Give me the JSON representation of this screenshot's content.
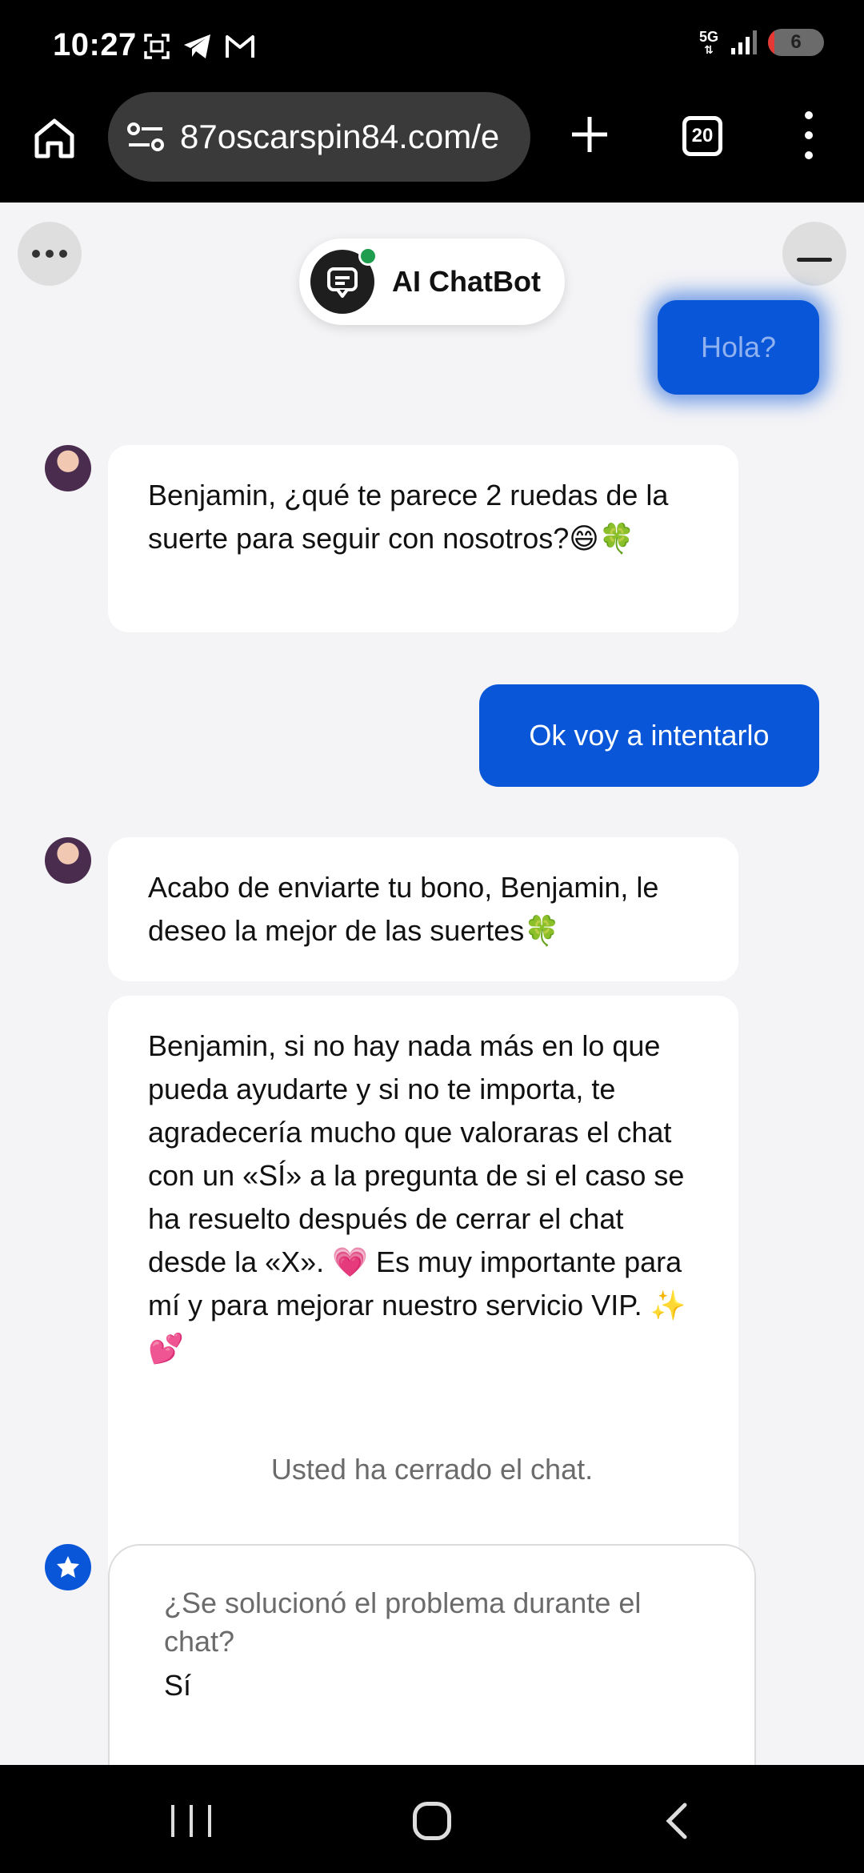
{
  "status_bar": {
    "time": "10:27",
    "network": "5G",
    "battery": "6",
    "battery_level": 0.06,
    "left_icons": [
      "screenshot-icon",
      "telegram-icon",
      "gmail-icon"
    ],
    "right_icons": [
      "5g-icon",
      "signal-icon",
      "battery-icon"
    ]
  },
  "browser": {
    "url": "87oscarspin84.com/e",
    "tab_count": "20"
  },
  "chat": {
    "bot_name": "AI ChatBot",
    "messages": {
      "user_1": "Hola?",
      "agent_1": "Benjamin, ¿qué te parece 2 ruedas de la suerte para seguir con nosotros?😄🍀",
      "user_2": "Ok voy a intentarlo",
      "agent_2": "Acabo de enviarte tu bono, Benjamin, le deseo la mejor de las suertes🍀",
      "agent_3": "Benjamin, si no hay nada más en lo que pueda ayudarte y si no te importa, te agradecería mucho que valoraras el chat con un «SÍ» a la pregunta de si el caso se ha resuelto después de cerrar el chat desde la «X». 💗 Es muy importante para mí y para mejorar nuestro servicio VIP. ✨💕"
    },
    "closed_notice": "Usted ha cerrado el chat.",
    "rating": {
      "question": "¿Se solucionó el problema durante el chat?",
      "answer": "Sí"
    }
  },
  "colors": {
    "accent": "#0a56d8",
    "chat_bg": "#f4f4f6",
    "online": "#1f9d4f"
  }
}
